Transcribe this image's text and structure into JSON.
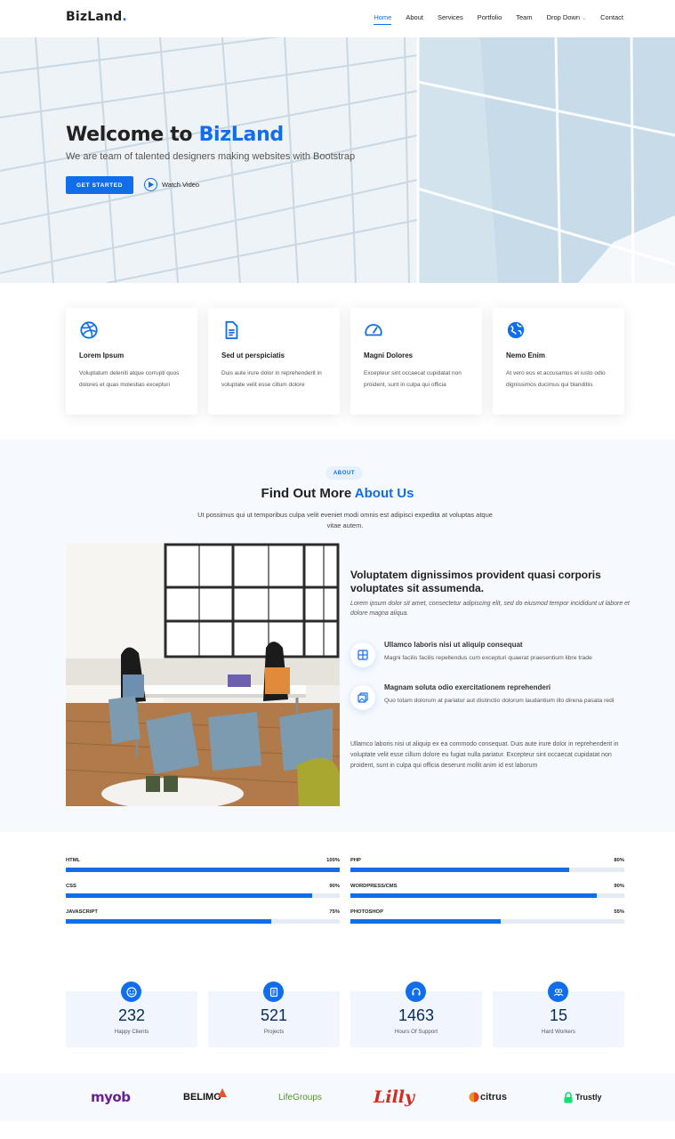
{
  "brand": {
    "name": "BizLand",
    "dot": "."
  },
  "nav": {
    "items": [
      {
        "label": "Home",
        "active": true
      },
      {
        "label": "About"
      },
      {
        "label": "Services"
      },
      {
        "label": "Portfolio"
      },
      {
        "label": "Team"
      },
      {
        "label": "Drop Down",
        "dropdown": true
      },
      {
        "label": "Contact"
      }
    ]
  },
  "hero": {
    "title_prefix": "Welcome to ",
    "title_brand": "BizLand",
    "subtitle": "We are team of talented designers making websites with Bootstrap",
    "cta_label": "GET STARTED",
    "video_label": "Watch Video"
  },
  "features": [
    {
      "icon": "dribbble-icon",
      "title": "Lorem Ipsum",
      "desc": "Voluptatum deleniti atque corrupti quos dolores et quas molestias excepturi"
    },
    {
      "icon": "file-icon",
      "title": "Sed ut perspiciatis",
      "desc": "Duis aute irure dolor in reprehenderit in voluptate velit esse cillum dolore"
    },
    {
      "icon": "tachometer-icon",
      "title": "Magni Dolores",
      "desc": "Excepteur sint occaecat cupidatat non proident, sunt in culpa qui officia"
    },
    {
      "icon": "world-icon",
      "title": "Nemo Enim",
      "desc": "At vero eos et accusamus et iusto odio dignissimos ducimus qui blanditiis"
    }
  ],
  "about": {
    "badge": "ABOUT",
    "heading_prefix": "Find Out More ",
    "heading_highlight": "About Us",
    "desc": "Ut possimus qui ut temporibus culpa velit eveniet modi omnis est adipisci expedita at voluptas atque vitae autem.",
    "h3": "Voluptatem dignissimos provident quasi corporis voluptates sit assumenda.",
    "lead": "Lorem ipsum dolor sit amet, consectetur adipiscing elit, sed do eiusmod tempor incididunt ut labore et dolore magna aliqua.",
    "items": [
      {
        "icon": "store-icon",
        "title": "Ullamco laboris nisi ut aliquip consequat",
        "desc": "Magni facilis facilis repellendus cum excepturi quaerat praesentium libre trade"
      },
      {
        "icon": "images-icon",
        "title": "Magnam soluta odio exercitationem reprehenderi",
        "desc": "Quo totam dolorum at pariatur aut distinctio dolorum laudantium illo direna pasata redi"
      }
    ],
    "footer_text": "Ullamco laboris nisi ut aliquip ex ea commodo consequat. Duis aute irure dolor in reprehenderit in voluptate velit esse cillum dolore eu fugiat nulla pariatur. Excepteur sint occaecat cupidatat non proident, sunt in culpa qui officia deserunt mollit anim id est laborum"
  },
  "skills": {
    "left": [
      {
        "name": "HTML",
        "label": "100%",
        "value": 100
      },
      {
        "name": "CSS",
        "label": "90%",
        "value": 90
      },
      {
        "name": "JAVASCRIPT",
        "label": "75%",
        "value": 75
      }
    ],
    "right": [
      {
        "name": "PHP",
        "label": "80%",
        "value": 80
      },
      {
        "name": "WORDPRESS/CMS",
        "label": "90%",
        "value": 90
      },
      {
        "name": "PHOTOSHOP",
        "label": "55%",
        "value": 55
      }
    ]
  },
  "counts": [
    {
      "icon": "smile-icon",
      "value": "232",
      "label": "Happy Clients"
    },
    {
      "icon": "journal-icon",
      "value": "521",
      "label": "Projects"
    },
    {
      "icon": "headset-icon",
      "value": "1463",
      "label": "Hours Of Support"
    },
    {
      "icon": "people-icon",
      "value": "15",
      "label": "Hard Workers"
    }
  ],
  "clients": [
    {
      "name": "myob",
      "color": "#6c1d9a"
    },
    {
      "name": "BELIMO",
      "color": "#111111"
    },
    {
      "name": "LifeGroups",
      "color": "#5a8f2e"
    },
    {
      "name": "Lilly",
      "color": "#d52b1e"
    },
    {
      "name": "citrus",
      "color": "#222222"
    },
    {
      "name": "Trustly",
      "color": "#1a1a1a"
    }
  ],
  "colors": {
    "accent": "#106eea",
    "dark": "#222222",
    "section_bg": "#f6f9fe"
  }
}
